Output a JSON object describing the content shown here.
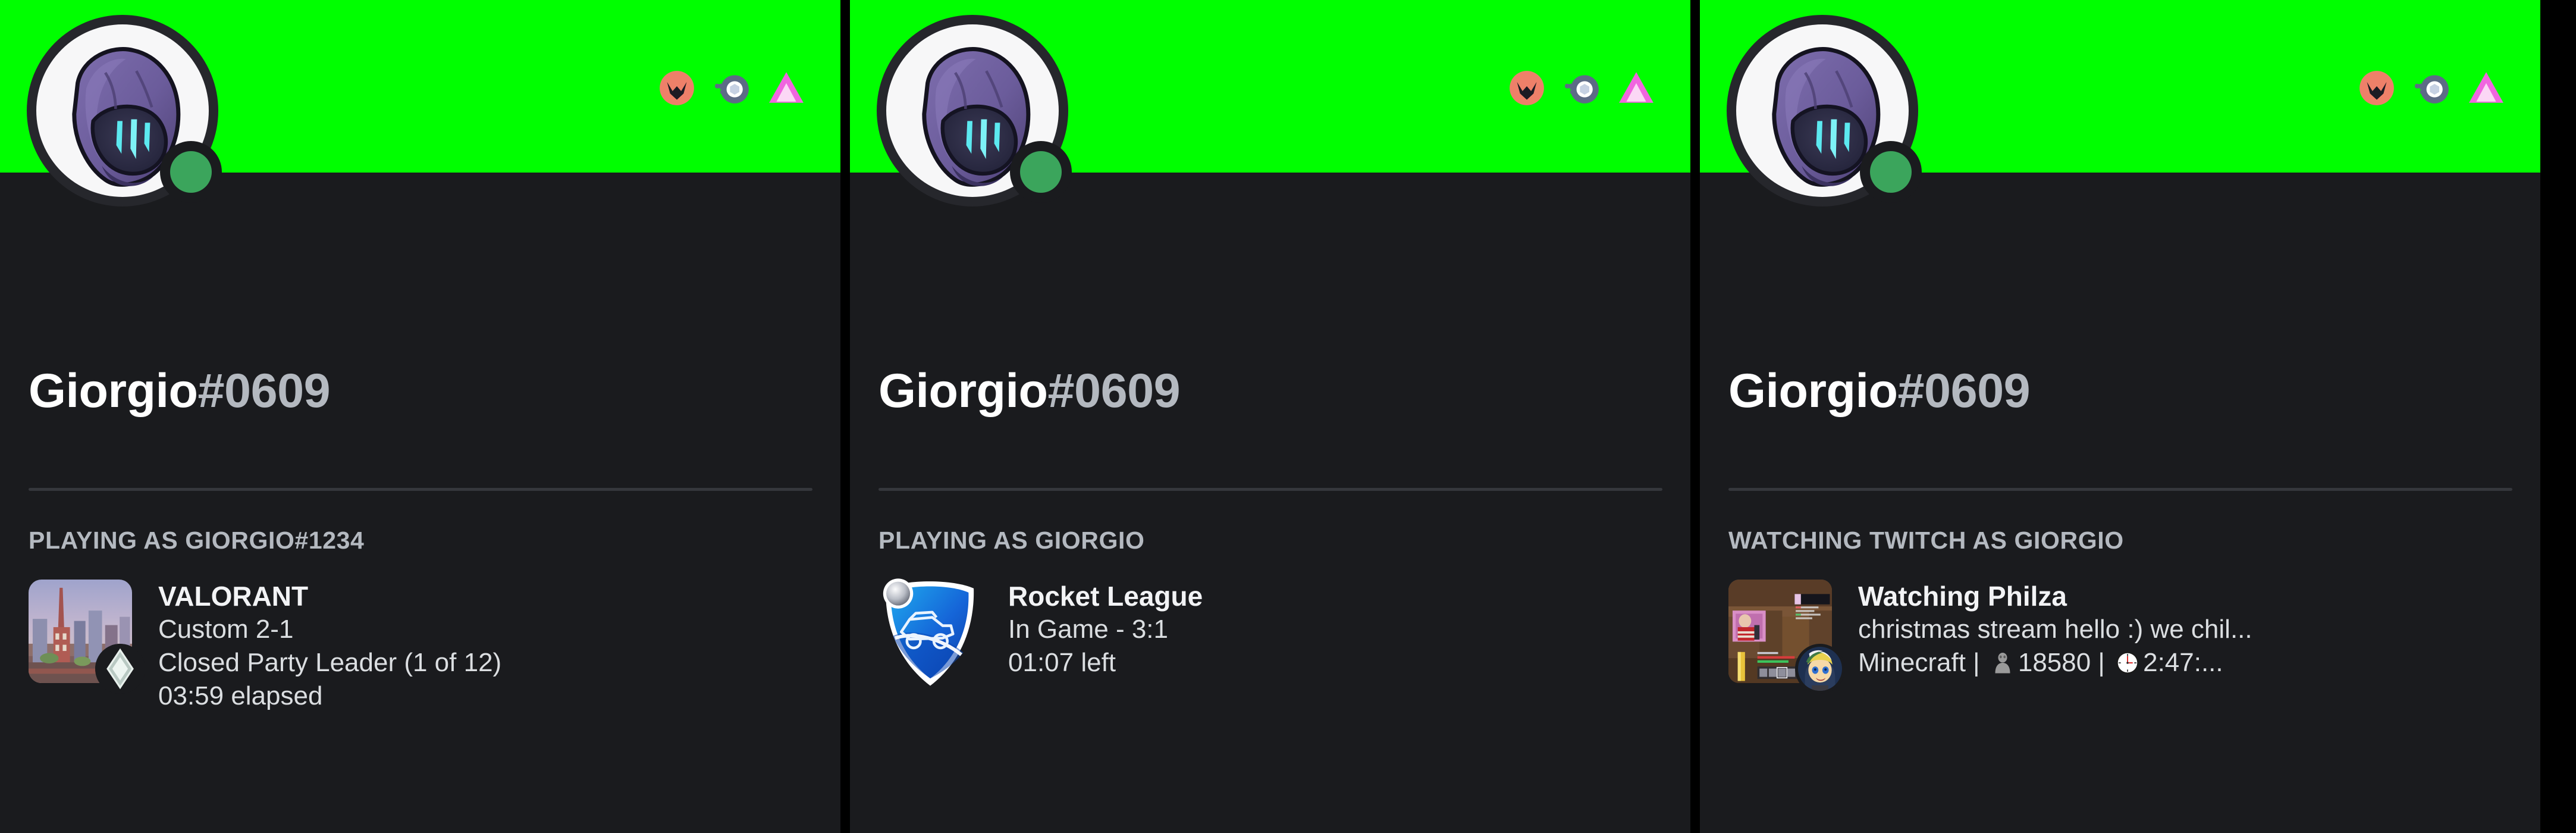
{
  "meta": {
    "banner_color": "#00FF00",
    "card_background": "#1A1B1E",
    "status_color": "#3BA55C",
    "username_color": "#FFFFFF",
    "discriminator_color": "#B4B9C0",
    "header_color": "#B4B9C0"
  },
  "badges": [
    {
      "name": "active-developer-badge",
      "color": "#EE8069",
      "label": "Active Developer"
    },
    {
      "name": "hypesquad-bravery-badge",
      "color": "#5D6B86",
      "label": "HypeSquad"
    },
    {
      "name": "nitro-triangle-badge",
      "color": "#F066DF",
      "label": "Nitro"
    }
  ],
  "cards": [
    {
      "id": "card-valorant",
      "status": "online",
      "username": "Giorgio",
      "discriminator": "#0609",
      "activity": {
        "header": "PLAYING AS GIORGIO#1234",
        "art_name": "valorant-map-art",
        "art_sub_name": "valorant-rank-icon",
        "title": "VALORANT",
        "lines": [
          "Custom 2-1",
          "Closed Party Leader (1 of 12)",
          "03:59 elapsed"
        ]
      }
    },
    {
      "id": "card-rocket-league",
      "status": "online",
      "username": "Giorgio",
      "discriminator": "#0609",
      "activity": {
        "header": "PLAYING AS GIORGIO",
        "art_name": "rocket-league-logo",
        "art_sub_name": "",
        "title": "Rocket League",
        "lines": [
          "In Game - 3:1",
          "01:07 left"
        ]
      }
    },
    {
      "id": "card-twitch",
      "status": "online",
      "username": "Giorgio",
      "discriminator": "#0609",
      "activity": {
        "header": "WATCHING TWITCH AS GIORGIO",
        "art_name": "twitch-stream-thumbnail",
        "art_sub_name": "streamer-avatar",
        "title": "Watching Philza",
        "lines": [
          "christmas stream hello :) we chil...",
          "Minecraft |  18580 |  2:47:..."
        ],
        "stream_game": "Minecraft",
        "stream_viewers": "18580",
        "stream_uptime": "2:47:...",
        "viewer_icon": "viewer-icon",
        "clock_icon": "clock-icon"
      }
    }
  ]
}
